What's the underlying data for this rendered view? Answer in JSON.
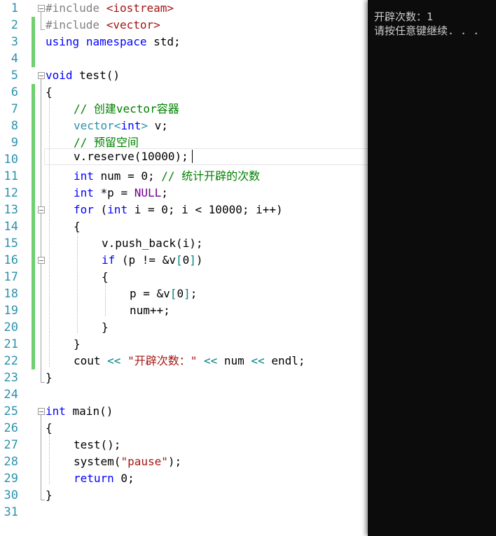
{
  "editor": {
    "line_numbers": [
      "1",
      "2",
      "3",
      "4",
      "5",
      "6",
      "7",
      "8",
      "9",
      "10",
      "11",
      "12",
      "13",
      "14",
      "15",
      "16",
      "17",
      "18",
      "19",
      "20",
      "21",
      "22",
      "23",
      "24",
      "25",
      "26",
      "27",
      "28",
      "29",
      "30",
      "31"
    ],
    "code": {
      "l1_pp": "#include ",
      "l1_hdr": "<iostream>",
      "l2_pp": "#include ",
      "l2_hdr": "<vector>",
      "l3_kw1": "using",
      "l3_kw2": "namespace",
      "l3_rest": " std;",
      "l5_kw": "void",
      "l5_rest": " test()",
      "l6": "{",
      "l7": "// 创建vector容器",
      "l8_ty": "vector",
      "l8_lt": "<",
      "l8_kw": "int",
      "l8_gt": ">",
      "l8_rest": " v;",
      "l9": "// 预留空间",
      "l10": "v.reserve(10000);",
      "l11_kw": "int",
      "l11_rest": " num = 0; ",
      "l11_cm": "// 统计开辟的次数",
      "l12_kw": "int",
      "l12_rest": " *p = ",
      "l12_mc": "NULL",
      "l12_end": ";",
      "l13_kw1": "for",
      "l13_a": " (",
      "l13_kw2": "int",
      "l13_b": " i = 0; i < 10000; i++)",
      "l14": "{",
      "l15": "v.push_back(i);",
      "l16_kw": "if",
      "l16_a": " (p != &v",
      "l16_b": "[",
      "l16_c": "0",
      "l16_d": "]",
      "l16_e": ")",
      "l17": "{",
      "l18_a": "p = &v",
      "l18_b": "[",
      "l18_c": "0",
      "l18_d": "]",
      "l18_e": ";",
      "l19": "num++;",
      "l20": "}",
      "l21": "}",
      "l22_a": "cout ",
      "l22_op1": "<<",
      "l22_st": " \"开辟次数：\"",
      "l22_b": " ",
      "l22_op2": "<<",
      "l22_c": " num ",
      "l22_op3": "<<",
      "l22_d": " endl;",
      "l23": "}",
      "l25_kw": "int",
      "l25_rest": " main()",
      "l26": "{",
      "l27": "test();",
      "l28_a": "system(",
      "l28_st": "\"pause\"",
      "l28_b": ");",
      "l29_kw": "return",
      "l29_rest": " 0;",
      "l30": "}"
    }
  },
  "console": {
    "line1": "开辟次数：1",
    "line2": "请按任意键继续. . ."
  },
  "colors": {
    "keyword": "#0000ff",
    "type": "#2b91af",
    "comment": "#008000",
    "string": "#a31515",
    "preprocessor": "#808080",
    "operator": "#008080",
    "macro": "#6f008a",
    "line_number": "#2b91af",
    "change_bar": "#6fd06f",
    "console_bg": "#0c0c0c",
    "console_text": "#cccccc"
  }
}
